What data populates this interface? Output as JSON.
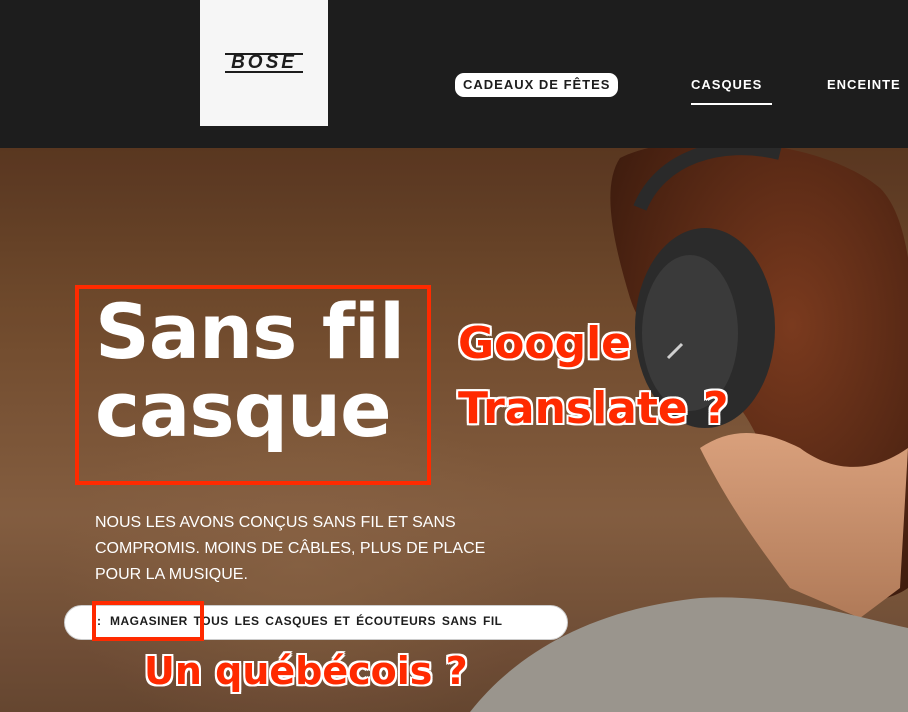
{
  "header": {
    "logo": "BOSE",
    "nav": [
      {
        "label": "CADEAUX DE FÊTES"
      },
      {
        "label": "CASQUES"
      },
      {
        "label": "ENCEINTE"
      }
    ]
  },
  "hero": {
    "headline_line1": "Sans fil",
    "headline_line2": "casque",
    "subtitle": "NOUS LES AVONS CONÇUS SANS FIL ET SANS COMPROMIS. MOINS DE CÂBLES, PLUS DE PLACE POUR LA MUSIQUE.",
    "cta_prefix": ":",
    "cta_label": "MAGASINER TOUS LES CASQUES ET ÉCOUTEURS SANS FIL"
  },
  "annotations": {
    "line1": "Google",
    "line2": "Translate ?",
    "line3": "Un québécois ?"
  },
  "colors": {
    "accent_red": "#ff2a00",
    "header_bg": "#1d1d1d"
  }
}
